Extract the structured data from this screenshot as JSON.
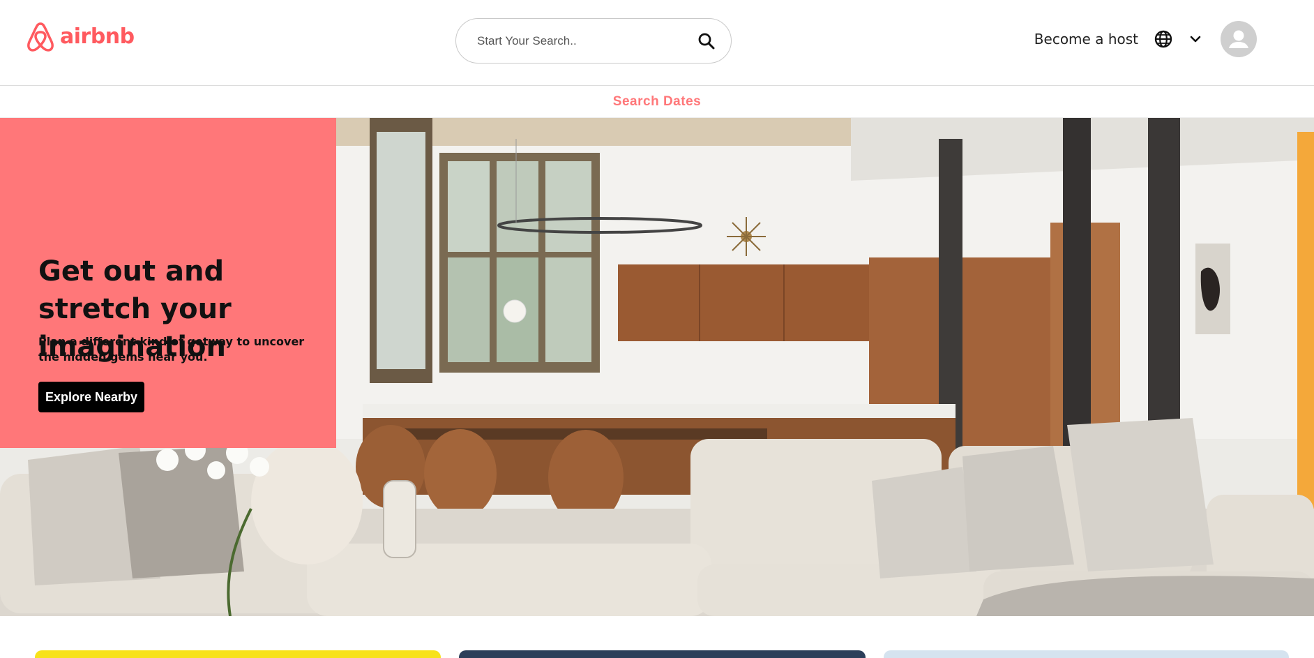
{
  "brand": {
    "name": "airbnb",
    "color": "#ff5a5f",
    "icon": "airbnb-logo-icon"
  },
  "search": {
    "placeholder": "Start Your Search..",
    "value": "",
    "icon": "search-icon"
  },
  "nav": {
    "host_label": "Become a host",
    "globe_icon": "globe-icon",
    "chevron_icon": "chevron-down-icon",
    "avatar_icon": "user-avatar-icon"
  },
  "dates": {
    "label": "Search Dates",
    "color": "#ff7779"
  },
  "hero": {
    "title": "Get out and stretch your imagination",
    "subtitle": "Plan a different kind of getway to uncover the hidden gems near you.",
    "button_label": "Explore Nearby",
    "card_color": "#ff7779",
    "image": "living-room-photo"
  },
  "cards": [
    {
      "color": "#f7e21a"
    },
    {
      "color": "#2c3f5a"
    },
    {
      "color": "#d5e3ef"
    }
  ]
}
